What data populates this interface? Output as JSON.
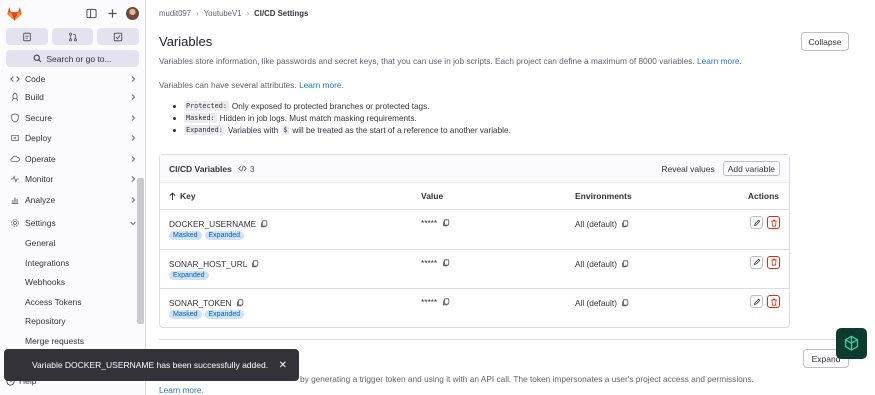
{
  "sidebar": {
    "search_label": "Search or go to...",
    "items": [
      {
        "label": "Code",
        "icon": "code-icon"
      },
      {
        "label": "Build",
        "icon": "rocket-icon"
      },
      {
        "label": "Secure",
        "icon": "shield-icon"
      },
      {
        "label": "Deploy",
        "icon": "deploy-icon"
      },
      {
        "label": "Operate",
        "icon": "cloud-icon"
      },
      {
        "label": "Monitor",
        "icon": "monitor-icon"
      },
      {
        "label": "Analyze",
        "icon": "chart-icon"
      },
      {
        "label": "Settings",
        "icon": "gear-icon"
      }
    ],
    "settings_sub": [
      "General",
      "Integrations",
      "Webhooks",
      "Access Tokens",
      "Repository",
      "Merge requests"
    ],
    "help_label": "Help"
  },
  "breadcrumb": [
    "mudit097",
    "YoutubeV1",
    "CI/CD Settings"
  ],
  "section": {
    "title": "Variables",
    "collapse_label": "Collapse",
    "description": "Variables store information, like passwords and secret keys, that you can use in job scripts. Each project can define a maximum of 8000 variables.",
    "learn_more": "Learn more.",
    "attrs_intro": "Variables can have several attributes.",
    "attrs": [
      {
        "code": "Protected:",
        "text": "Only exposed to protected branches or protected tags."
      },
      {
        "code": "Masked:",
        "text": "Hidden in job logs. Must match masking requirements."
      },
      {
        "code": "Expanded:",
        "text_before": "Variables with",
        "inline_code": "$",
        "text_after": "will be treated as the start of a reference to another variable."
      }
    ]
  },
  "table": {
    "title": "CI/CD Variables",
    "count": "3",
    "reveal_label": "Reveal values",
    "add_label": "Add variable",
    "headers": {
      "key": "Key",
      "value": "Value",
      "env": "Environments",
      "actions": "Actions"
    },
    "rows": [
      {
        "key": "DOCKER_USERNAME",
        "badges": [
          "Masked",
          "Expanded"
        ],
        "value": "*****",
        "env": "All (default)"
      },
      {
        "key": "SONAR_HOST_URL",
        "badges": [
          "Expanded"
        ],
        "value": "*****",
        "env": "All (default)"
      },
      {
        "key": "SONAR_TOKEN",
        "badges": [
          "Masked",
          "Expanded"
        ],
        "value": "*****",
        "env": "All (default)"
      }
    ]
  },
  "trigger": {
    "expand_label": "Expand",
    "description": "by generating a trigger token and using it with an API call. The token impersonates a user's project access and permissions.",
    "learn_more": "Learn more."
  },
  "toast": {
    "message": "Variable DOCKER_USERNAME has been successfully added.",
    "close": "✕"
  },
  "colors": {
    "accent": "#6e49cb",
    "link": "#1f75cb",
    "danger": "#dd2b0e",
    "badge_bg": "#cbe2f9"
  }
}
